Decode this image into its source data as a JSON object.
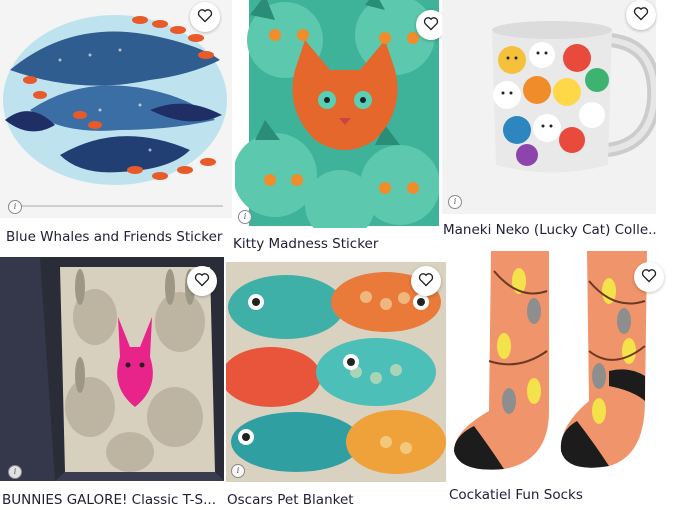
{
  "products": [
    {
      "title": "Blue Whales and Friends Sticker",
      "favorite_icon": "heart-outline-icon",
      "info_icon": "info-icon"
    },
    {
      "title": "Kitty Madness Sticker",
      "favorite_icon": "heart-outline-icon",
      "info_icon": "info-icon"
    },
    {
      "title": "Maneki Neko (Lucky Cat) Colle..",
      "favorite_icon": "heart-outline-icon",
      "info_icon": "info-icon"
    },
    {
      "title": "BUNNIES GALORE! Classic T-S...",
      "favorite_icon": "heart-outline-icon",
      "info_icon": "info-icon"
    },
    {
      "title": "Oscars Pet Blanket",
      "favorite_icon": "heart-outline-icon",
      "info_icon": "info-icon"
    },
    {
      "title": "Cockatiel Fun Socks",
      "favorite_icon": "heart-outline-icon",
      "info_icon": "info-icon"
    }
  ],
  "info_glyph": "i",
  "colors": {
    "title_text": "#20203a",
    "card_bg": "#f2f2f2"
  }
}
